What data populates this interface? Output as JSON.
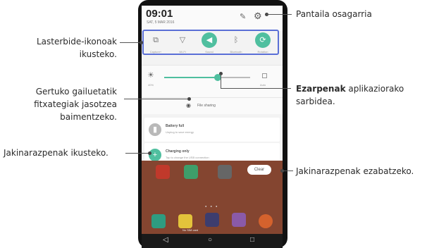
{
  "phone": {
    "time": "09:01",
    "date": "SAT, 5 MAR 2016",
    "quick_settings": [
      {
        "label": "Capture+",
        "icon": "capture-icon",
        "on": false
      },
      {
        "label": "Wi-Fi",
        "icon": "wifi-icon",
        "on": false
      },
      {
        "label": "Sound",
        "icon": "sound-icon",
        "on": true
      },
      {
        "label": "Bluetooth",
        "icon": "bluetooth-icon",
        "on": false
      },
      {
        "label": "Rotation",
        "icon": "rotation-icon",
        "on": true
      }
    ],
    "brightness": {
      "percent_label": "40%",
      "level": 0.62,
      "auto_label": "Auto"
    },
    "file_sharing_label": "File sharing",
    "notifications": [
      {
        "title": "Battery full",
        "subtitle": "Unplug to save energy",
        "icon": "battery-icon"
      },
      {
        "title": "Charging only",
        "subtitle": "Tap to change the USB connection",
        "icon": "usb-icon"
      }
    ],
    "clear_label": "Clear",
    "carrier_label": "No SIM card",
    "accent_color": "#4fbf9f"
  },
  "callouts": {
    "settings": "Pantaila osagarria",
    "quick_icons_line1": "Lasterbide-ikonoak",
    "quick_icons_line2": "ikusteko.",
    "nearby_line1": "Gertuko gailuetatik",
    "nearby_line2": "fitxategiak jasotzea",
    "nearby_line3": "baimentzeko.",
    "notifications": "Jakinarazpenak ikusteko.",
    "settings_app_bold": "Ezarpenak",
    "settings_app_rest": " aplikaziorako",
    "settings_app_line2": "sarbidea.",
    "clear": "Jakinarazpenak ezabatzeko."
  }
}
